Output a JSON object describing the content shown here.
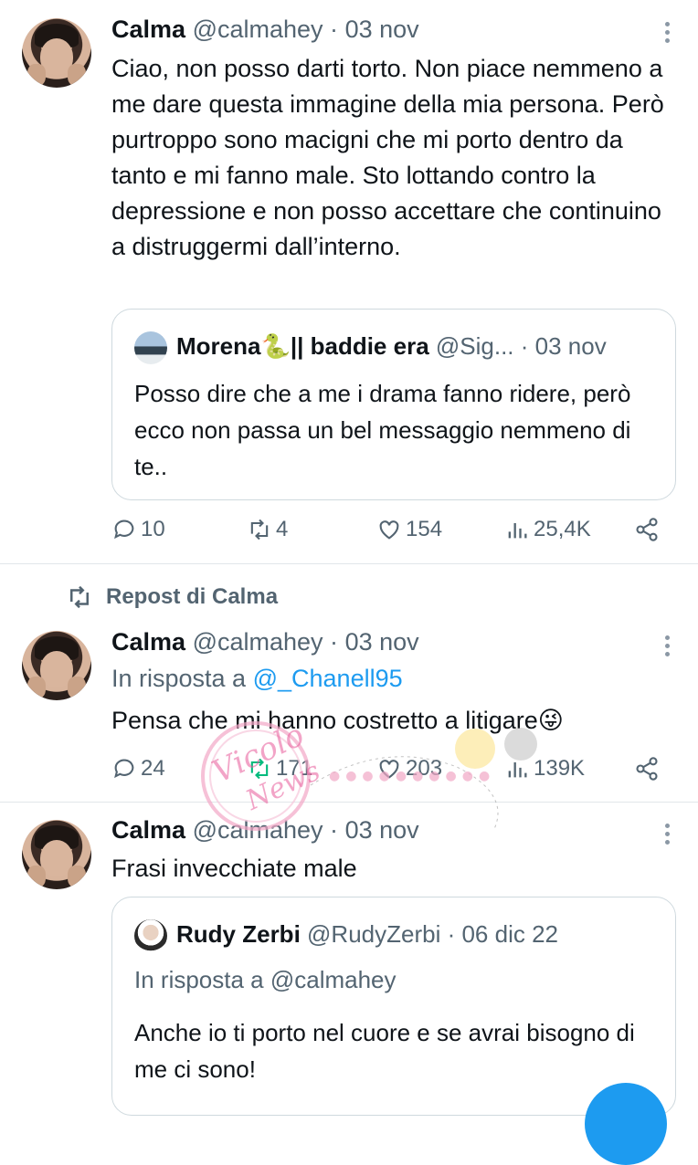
{
  "tweet1": {
    "name": "Calma",
    "handle": "@calmahey",
    "sep": "·",
    "date": "03 nov",
    "text": "Ciao, non posso darti torto. Non piace nemmeno a me dare questa immagine della mia persona. Però purtroppo sono macigni che mi porto dentro da tanto e mi fanno male. Sto lottando contro la depressione e non posso accettare che continuino a distruggermi dall’interno.",
    "quote": {
      "name": "Morena🐍|| baddie era",
      "handle": "@Sig...",
      "date": "· 03 nov",
      "text": "Posso dire che a me i drama fanno ridere, però ecco non passa un bel messaggio nemmeno di te.."
    },
    "replies": "10",
    "reposts": "4",
    "likes": "154",
    "views": "25,4K"
  },
  "repost_label": "Repost di Calma",
  "tweet2": {
    "name": "Calma",
    "handle": "@calmahey",
    "sep": "·",
    "date": "03 nov",
    "reply_prefix": "In risposta a",
    "reply_to": "@_Chanell95",
    "text": "Pensa che mi hanno costretto a litigare😜",
    "replies": "24",
    "reposts": "171",
    "likes": "203",
    "views": "139K"
  },
  "tweet3": {
    "name": "Calma",
    "handle": "@calmahey",
    "sep": "·",
    "date": "03 nov",
    "text": "Frasi invecchiate male",
    "quote": {
      "name": "Rudy Zerbi",
      "handle": "@RudyZerbi",
      "date": "· 06 dic 22",
      "reply_prefix": "In risposta a @calmahey",
      "text": "Anche io ti porto nel cuore e se avrai bisogno di me ci sono!"
    }
  },
  "watermark": {
    "text": "Vicolo News",
    "color": "#e85b9a"
  },
  "colors": {
    "accent": "#1d9bf0",
    "secondary_text": "#536471",
    "border": "#cfd9de"
  }
}
